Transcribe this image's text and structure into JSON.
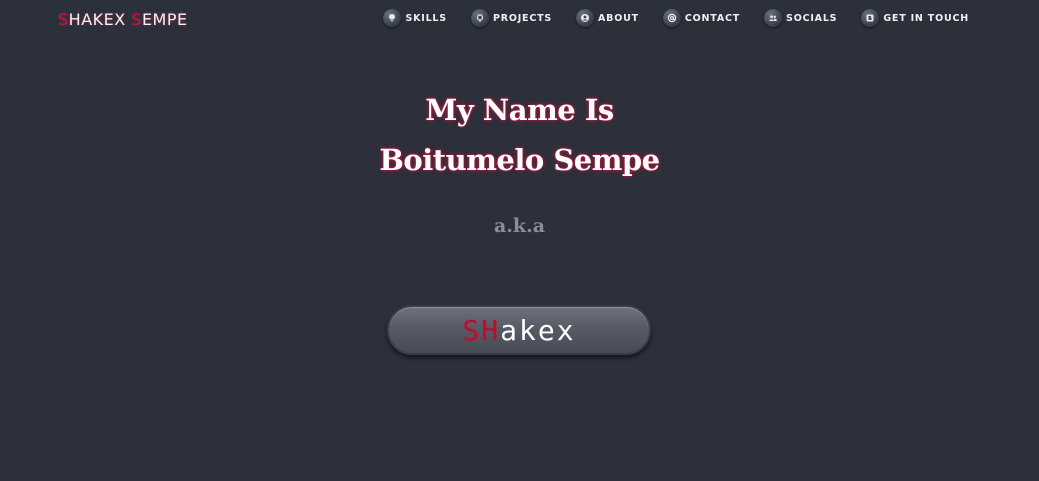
{
  "navbar": {
    "brand": {
      "first_initial": "S",
      "first_rest": "HAKEX ",
      "last_initial": "S",
      "last_rest": "EMPE"
    },
    "links": [
      {
        "label": "SKILLS",
        "icon": "lightbulb-icon"
      },
      {
        "label": "PROJECTS",
        "icon": "github-icon"
      },
      {
        "label": "ABOUT",
        "icon": "user-circle-icon"
      },
      {
        "label": "CONTACT",
        "icon": "at-sign-icon"
      },
      {
        "label": "SOCIALS",
        "icon": "users-icon"
      },
      {
        "label": "GET IN TOUCH",
        "icon": "blogger-icon"
      }
    ]
  },
  "hero": {
    "line1": "My Name Is",
    "line2": "Boitumelo Sempe",
    "aka": "a.k.a",
    "nickname": {
      "accent": "SH",
      "rest": "akex"
    }
  },
  "colors": {
    "background": "#2b303b",
    "accent": "#c8143c",
    "muted_text": "#8f8a97",
    "button": "#575b65"
  }
}
